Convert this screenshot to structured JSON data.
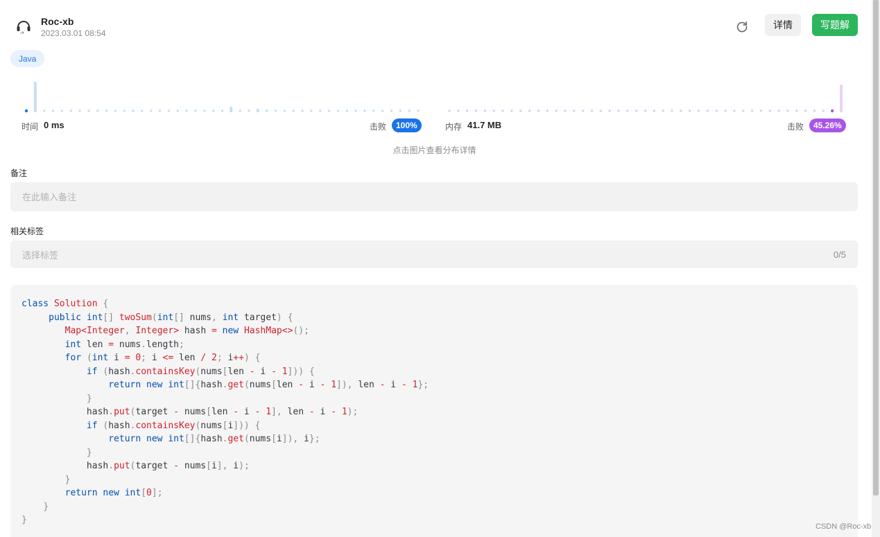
{
  "header": {
    "user_name": "Roc-xb",
    "timestamp": "2023.03.01 08:54",
    "avatar_icon": "headset-avatar-icon",
    "refresh_icon": "refresh-icon",
    "detail_label": "详情",
    "write_solution_label": "写题解"
  },
  "language_tag": "Java",
  "stats": {
    "time_label": "时间",
    "time_value": "0 ms",
    "time_beat_label": "击败",
    "time_beat_value": "100%",
    "time_beat_fraction": 1.0,
    "memory_label": "内存",
    "memory_value": "41.7 MB",
    "memory_beat_label": "击败",
    "memory_beat_value": "45.26%",
    "memory_beat_fraction": 0.4526,
    "time_color": "#1a73e8",
    "memory_color": "#a855e6"
  },
  "distribution_hint": "点击图片查看分布详情",
  "note": {
    "label": "备注",
    "placeholder": "在此输入备注"
  },
  "tags": {
    "label": "相关标签",
    "placeholder": "选择标签",
    "count": "0/5"
  },
  "code_lines": [
    "class Solution {",
    "     public int[] twoSum(int[] nums, int target) {",
    "        Map<Integer, Integer> hash = new HashMap<>();",
    "        int len = nums.length;",
    "        for (int i = 0; i <= len / 2; i++) {",
    "            if (hash.containsKey(nums[len - i - 1])) {",
    "                return new int[]{hash.get(nums[len - i - 1]), len - i - 1};",
    "            }",
    "            hash.put(target - nums[len - i - 1], len - i - 1);",
    "            if (hash.containsKey(nums[i])) {",
    "                return new int[]{hash.get(nums[i]), i};",
    "            }",
    "            hash.put(target - nums[i], i);",
    "        }",
    "        return new int[0];",
    "    }",
    "}"
  ],
  "watermark": "CSDN @Roc-xb"
}
